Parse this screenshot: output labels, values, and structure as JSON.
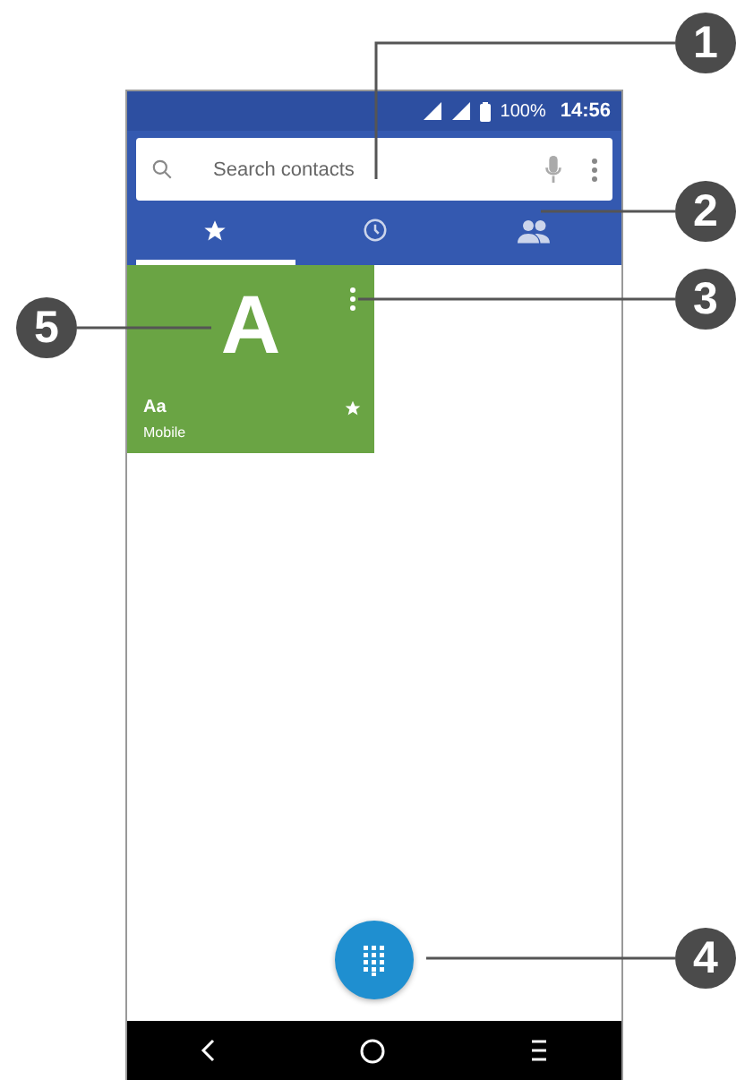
{
  "status_bar": {
    "battery": "100%",
    "time": "14:56"
  },
  "search": {
    "placeholder": "Search contacts"
  },
  "tabs": [
    {
      "kind": "favorites",
      "selected": true
    },
    {
      "kind": "recent",
      "selected": false
    },
    {
      "kind": "contacts",
      "selected": false
    }
  ],
  "favorites": [
    {
      "initial": "A",
      "name": "Aa",
      "phone_type": "Mobile",
      "starred": true,
      "color": "#6aa444"
    }
  ],
  "callouts": [
    {
      "label": "1"
    },
    {
      "label": "2"
    },
    {
      "label": "3"
    },
    {
      "label": "4"
    },
    {
      "label": "5"
    }
  ]
}
